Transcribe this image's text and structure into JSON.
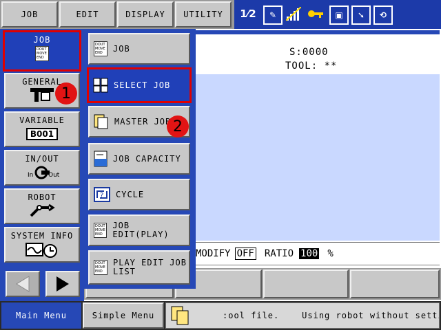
{
  "top_menu": [
    "JOB",
    "EDIT",
    "DISPLAY",
    "UTILITY"
  ],
  "toolbar_icons": [
    "job-number-icon",
    "edit-mode-icon",
    "signal-icon",
    "key-icon",
    "image-icon",
    "export-icon",
    "cycle-icon"
  ],
  "status": {
    "s_value": "S:0000",
    "tool": "TOOL: **",
    "modify_label": "MODIFY",
    "modify_value": "OFF",
    "ratio_label": "RATIO",
    "ratio_value": "100",
    "percent": "%"
  },
  "left_menu": [
    {
      "label": "JOB",
      "icon": "job-doc-icon",
      "icon_text": [
        "DOUT",
        "MOVE",
        "END"
      ]
    },
    {
      "label": "GENERAL",
      "icon": "welding-gun-icon"
    },
    {
      "label": "VARIABLE",
      "icon": "variable-box",
      "icon_text": "B001"
    },
    {
      "label": "IN/OUT",
      "icon": "in-out-icon",
      "in_text": "In",
      "out_text": "Out"
    },
    {
      "label": "ROBOT",
      "icon": "robot-arm-icon"
    },
    {
      "label": "SYSTEM INFO",
      "icon": "system-info-icon"
    }
  ],
  "submenu": [
    {
      "label": "JOB",
      "icon": "job-doc-icon"
    },
    {
      "label": "SELECT JOB",
      "icon": "select-job-icon"
    },
    {
      "label": "MASTER JOB",
      "icon": "master-job-icon"
    },
    {
      "label": "JOB CAPACITY",
      "icon": "job-capacity-icon"
    },
    {
      "label": "CYCLE",
      "icon": "cycle-icon"
    },
    {
      "label": "JOB EDIT(PLAY)",
      "icon": "job-doc-icon"
    },
    {
      "label": "PLAY EDIT JOB\nLIST",
      "icon": "job-doc-icon"
    }
  ],
  "job_icon_text": [
    "DOUT",
    "MOVE",
    "END"
  ],
  "badges": [
    "1",
    "2"
  ],
  "bottom": {
    "main_menu": "Main Menu",
    "simple_menu": "Simple Menu",
    "message": ":ool file.    Using robot without setting t"
  },
  "colors": {
    "panel_blue": "#2648b6",
    "highlight_blue": "#2040b8",
    "highlight_red": "#e00000",
    "button_gray": "#c8c8c8"
  }
}
